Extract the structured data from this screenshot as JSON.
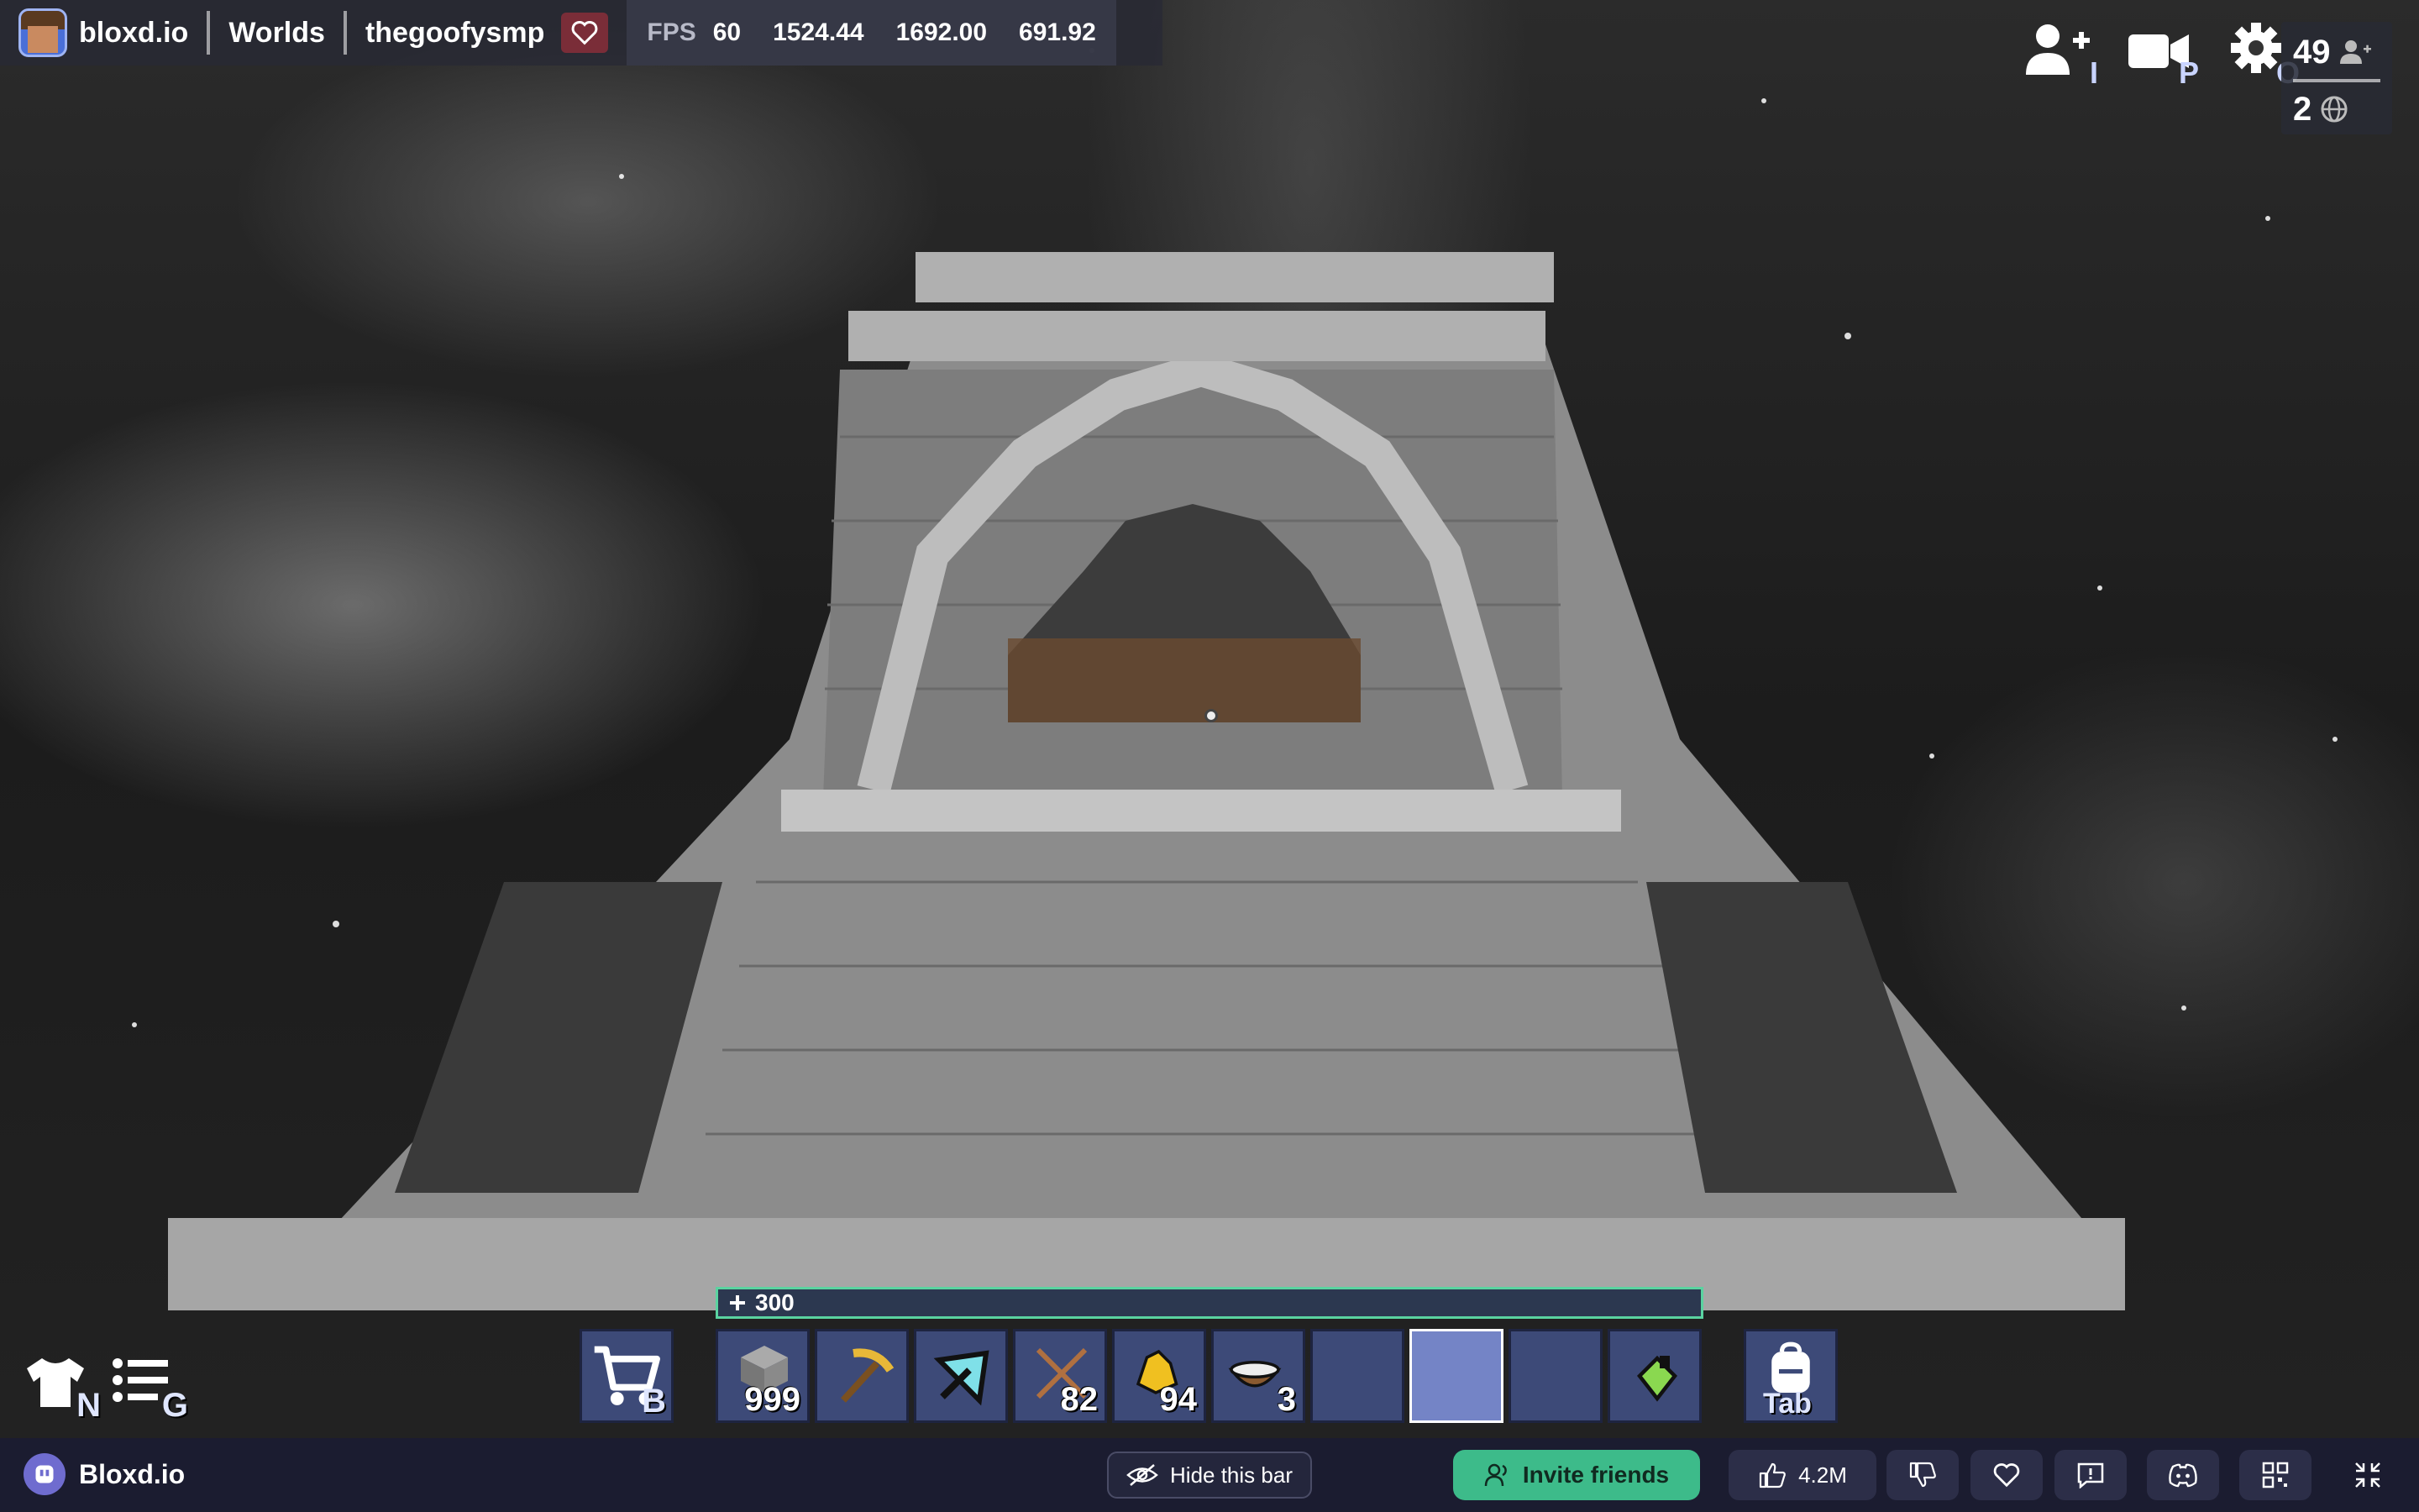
{
  "topbar": {
    "brand": "bloxd.io",
    "worlds": "Worlds",
    "server_name": "thegoofysmp",
    "fps_label": "FPS",
    "fps_value": "60",
    "coord_x": "1524.44",
    "coord_y": "1692.00",
    "coord_z": "691.92"
  },
  "top_right": {
    "invite_key": "I",
    "record_key": "P",
    "settings_key": "O",
    "players_local": "49",
    "players_global": "2"
  },
  "health": {
    "value": "300"
  },
  "hotbar": {
    "shop_key": "B",
    "bag_key": "Tab",
    "slots": [
      {
        "item": "stone-block",
        "qty": "999"
      },
      {
        "item": "gold-pickaxe",
        "qty": ""
      },
      {
        "item": "diamond-tool",
        "qty": ""
      },
      {
        "item": "crossed-arrows",
        "qty": "82"
      },
      {
        "item": "gold-nugget",
        "qty": "94"
      },
      {
        "item": "bowl",
        "qty": "3"
      },
      {
        "item": "empty",
        "qty": ""
      },
      {
        "item": "empty-selected",
        "qty": ""
      },
      {
        "item": "empty",
        "qty": ""
      },
      {
        "item": "green-potion",
        "qty": ""
      }
    ]
  },
  "bottom_left": {
    "outfit_key": "N",
    "list_key": "G"
  },
  "bottombar": {
    "brand": "Bloxd.io",
    "hide_bar": "Hide this bar",
    "invite": "Invite friends",
    "likes": "4.2M"
  },
  "colors": {
    "hotbar_slot": "#3d4a78",
    "hotbar_selected": "#7484c6",
    "invite_green": "#3dbb8a",
    "health_border": "#5ad3a0"
  }
}
